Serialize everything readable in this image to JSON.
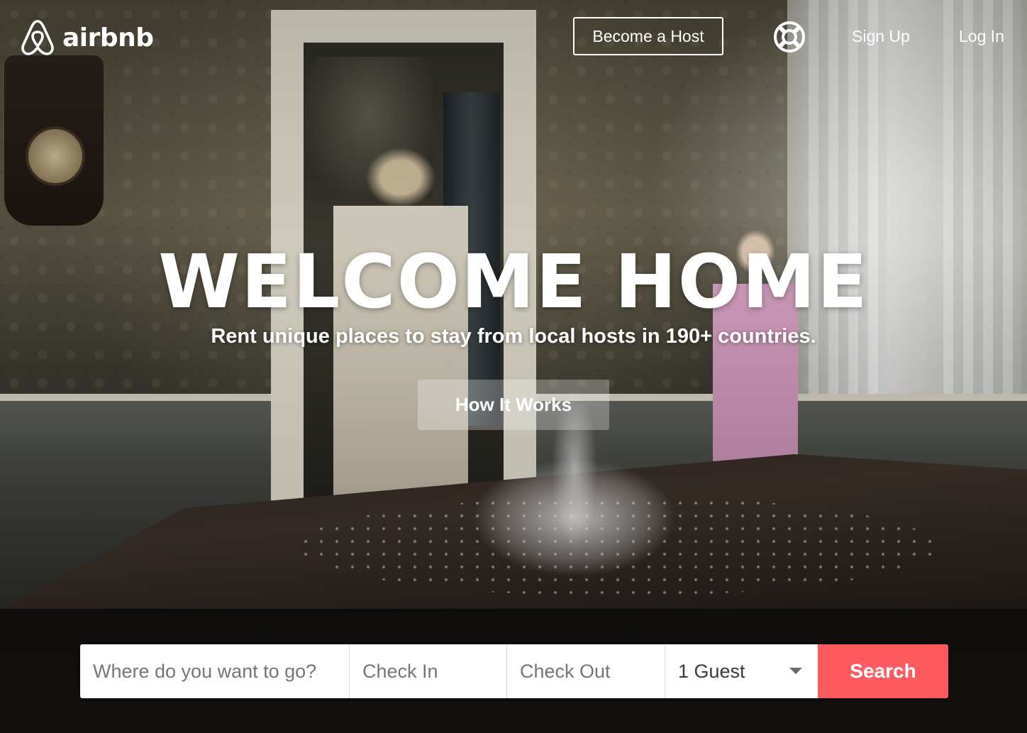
{
  "brand": {
    "name": "airbnb",
    "accent_color": "#ff5a5f"
  },
  "header": {
    "become_host": "Become a Host",
    "help_icon": "lifebuoy-icon",
    "sign_up": "Sign Up",
    "log_in": "Log In"
  },
  "hero": {
    "title": "WELCOME HOME",
    "subtitle": "Rent unique places to stay from local hosts in 190+ countries.",
    "cta": "How It Works"
  },
  "search": {
    "where_placeholder": "Where do you want to go?",
    "checkin_placeholder": "Check In",
    "checkout_placeholder": "Check Out",
    "guests_value": "1 Guest",
    "button_label": "Search"
  }
}
